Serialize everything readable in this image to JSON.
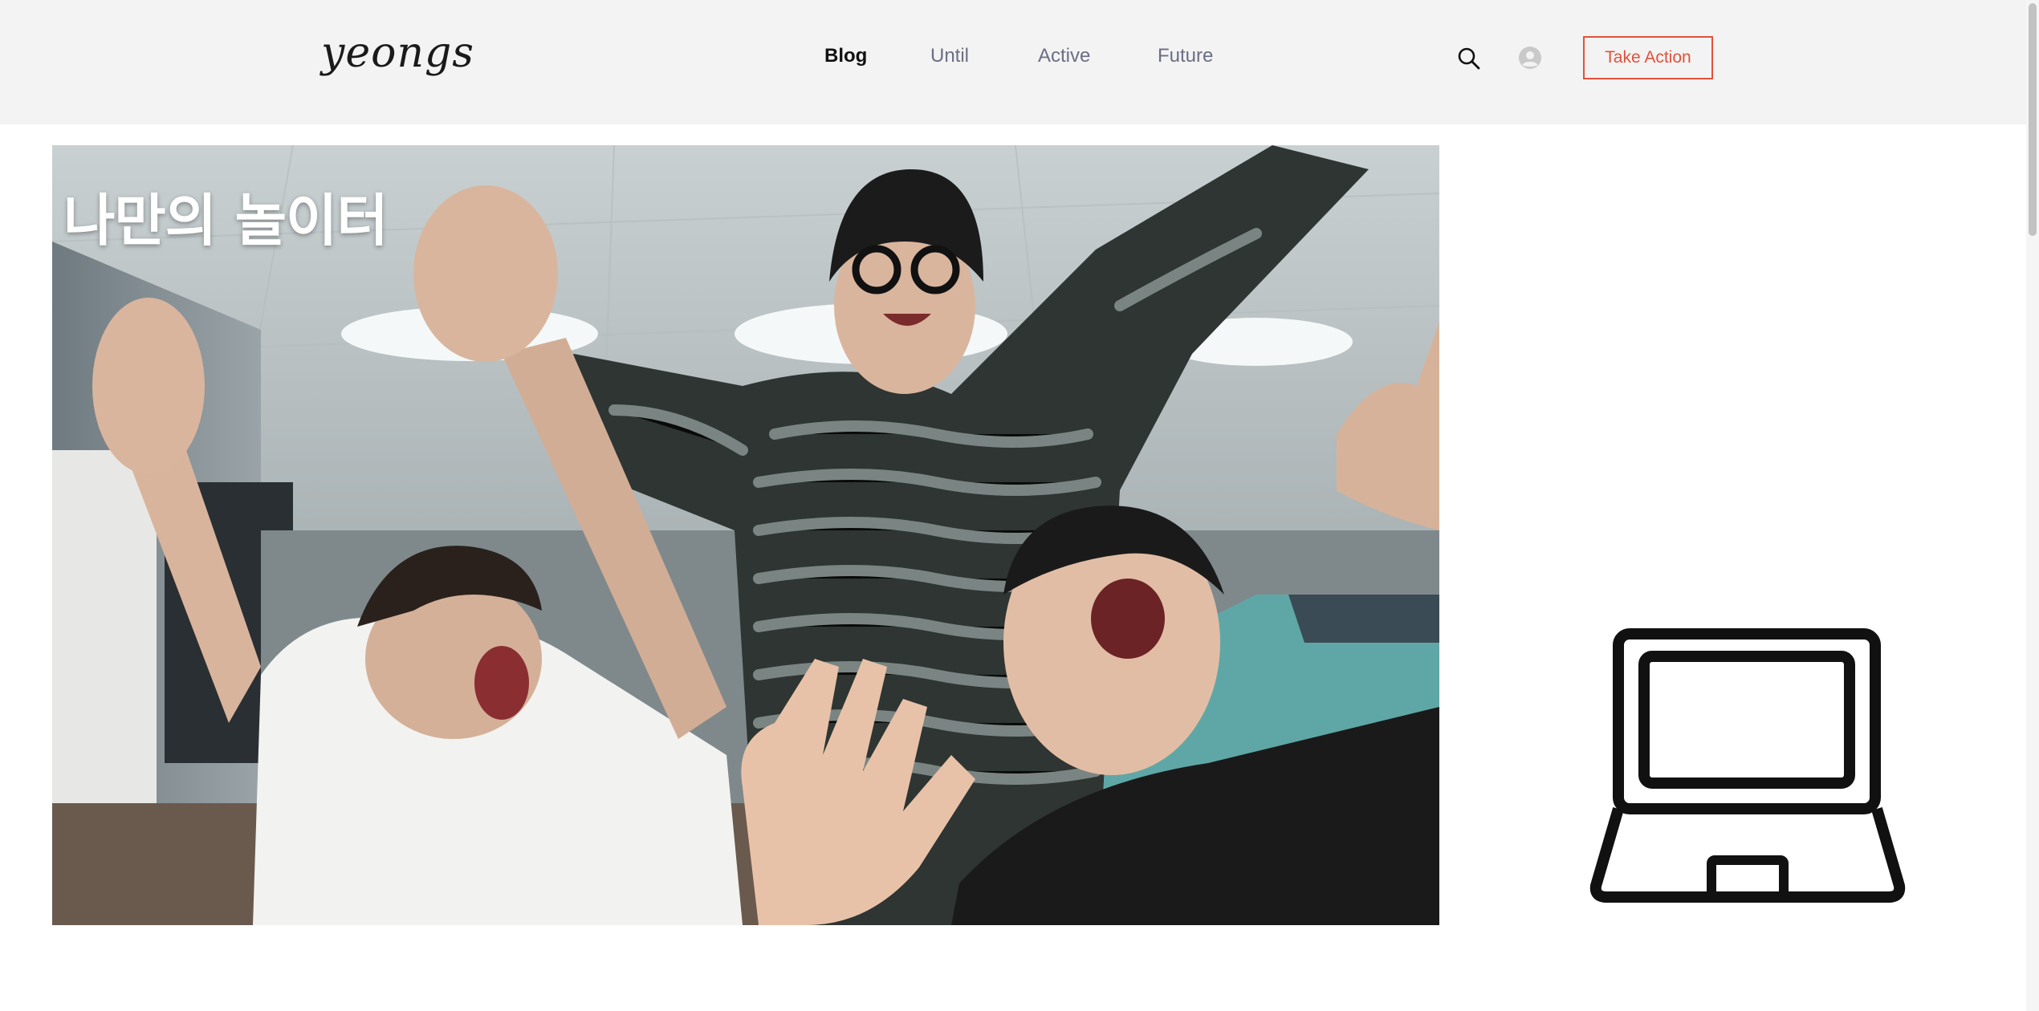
{
  "header": {
    "logo": "yeongs",
    "nav": [
      {
        "label": "Blog",
        "active": true
      },
      {
        "label": "Until",
        "active": false
      },
      {
        "label": "Active",
        "active": false
      },
      {
        "label": "Future",
        "active": false
      }
    ],
    "icons": {
      "search": "search-icon",
      "account": "user-avatar-icon"
    },
    "cta_label": "Take Action",
    "accent_color": "#e2513a"
  },
  "hero": {
    "title": "나만의 놀이터",
    "image": "photo of three people celebrating with raised hands"
  },
  "side": {
    "icon": "laptop-icon"
  }
}
